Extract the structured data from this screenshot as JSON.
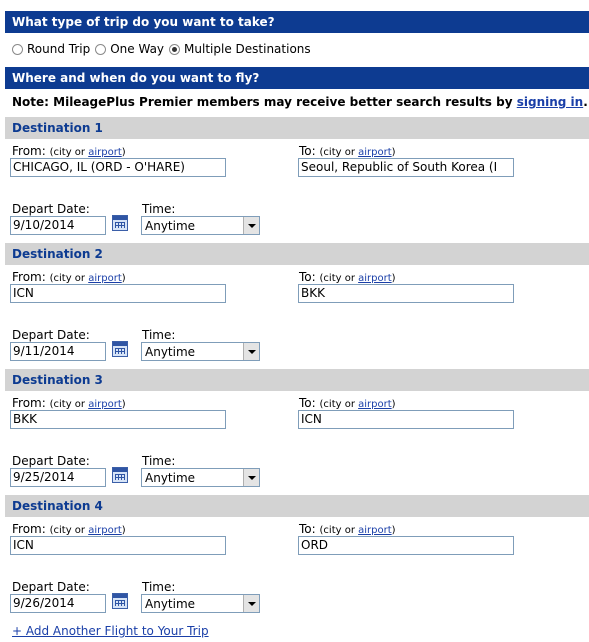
{
  "trip_type": {
    "heading": "What type of trip do you want to take?",
    "options": [
      {
        "label": "Round Trip",
        "checked": false
      },
      {
        "label": "One Way",
        "checked": false
      },
      {
        "label": "Multiple Destinations",
        "checked": true
      }
    ]
  },
  "when_where": {
    "heading": "Where and when do you want to fly?",
    "note_prefix": "Note: MileagePlus Premier members may receive better search results by ",
    "note_link": "signing in",
    "note_suffix": "."
  },
  "labels": {
    "from": "From:",
    "to": "To:",
    "sub_open": "(city or ",
    "sub_link": "airport",
    "sub_close": ")",
    "depart_date": "Depart Date:",
    "time": "Time:"
  },
  "destinations": [
    {
      "title": "Destination 1",
      "from": "CHICAGO, IL (ORD - O'HARE)",
      "to": "Seoul, Republic of South Korea (I",
      "date": "9/10/2014",
      "time": "Anytime"
    },
    {
      "title": "Destination 2",
      "from": "ICN",
      "to": "BKK",
      "date": "9/11/2014",
      "time": "Anytime"
    },
    {
      "title": "Destination 3",
      "from": "BKK",
      "to": "ICN",
      "date": "9/25/2014",
      "time": "Anytime"
    },
    {
      "title": "Destination 4",
      "from": "ICN",
      "to": "ORD",
      "date": "9/26/2014",
      "time": "Anytime"
    }
  ],
  "add_flight": "+ Add Another Flight to Your Trip",
  "colors": {
    "header_bg": "#0d3b91",
    "dest_bg": "#d3d3d3",
    "link": "#1a3fa8"
  },
  "icons": {
    "calendar": "calendar-icon",
    "dropdown": "chevron-down-icon"
  }
}
